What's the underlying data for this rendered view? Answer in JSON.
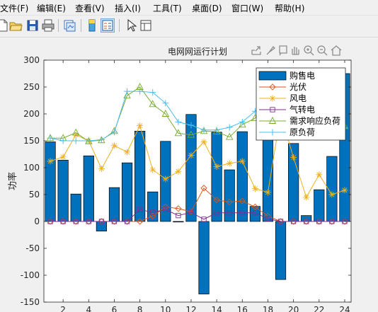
{
  "menu": [
    "文件(F)",
    "编辑(E)",
    "查看(V)",
    "插入(I)",
    "工具(T)",
    "桌面(D)",
    "窗口(W)",
    "帮助(H)"
  ],
  "toolbar": {
    "icons": [
      "new-file-icon",
      "open-folder-icon",
      "save-icon",
      "print-icon",
      "copy-figure-icon",
      "colorbar-icon",
      "legend-icon",
      "pointer-icon",
      "property-editor-icon"
    ]
  },
  "axes_toolbar": {
    "icons": [
      "export-icon",
      "brush-icon",
      "data-tips-icon",
      "pan-hand-icon",
      "zoom-in-icon",
      "zoom-out-icon",
      "home-icon"
    ]
  },
  "chart_data": {
    "type": "bar",
    "title": "电网网运行计划",
    "xlabel": "",
    "ylabel": "功率",
    "xlim": [
      0.5,
      24.5
    ],
    "ylim": [
      -150,
      300
    ],
    "yticks": [
      -150,
      -100,
      -50,
      0,
      50,
      100,
      150,
      200,
      250,
      300
    ],
    "xticks": [
      2,
      4,
      6,
      8,
      10,
      12,
      14,
      16,
      18,
      20,
      22,
      24
    ],
    "x": [
      1,
      2,
      3,
      4,
      5,
      6,
      7,
      8,
      9,
      10,
      11,
      12,
      13,
      14,
      15,
      16,
      17,
      18,
      19,
      20,
      21,
      22,
      23,
      24
    ],
    "grid": false,
    "legend_position": "top-right",
    "series": [
      {
        "name": "购售电",
        "kind": "bar",
        "color": "#0072bd",
        "values": [
          148,
          114,
          51,
          122,
          -18,
          63,
          109,
          168,
          55,
          149,
          -1,
          199,
          -135,
          166,
          96,
          167,
          28,
          160,
          -108,
          145,
          11,
          59,
          121,
          275
        ]
      },
      {
        "name": "光伏",
        "kind": "line",
        "marker": "diamond",
        "color": "#d95319",
        "values": [
          0,
          0,
          0,
          0,
          0,
          0,
          0,
          0,
          10,
          27,
          24,
          18,
          62,
          40,
          36,
          38,
          27,
          10,
          0,
          0,
          0,
          0,
          0,
          0
        ]
      },
      {
        "name": "风电",
        "kind": "line",
        "marker": "star",
        "color": "#edb120",
        "values": [
          112,
          120,
          161,
          150,
          98,
          141,
          129,
          178,
          96,
          79,
          93,
          123,
          148,
          102,
          108,
          112,
          61,
          54,
          200,
          119,
          45,
          87,
          50,
          58
        ]
      },
      {
        "name": "气转电",
        "kind": "line",
        "marker": "square",
        "color": "#7e2f8e",
        "values": [
          0,
          0,
          0,
          0,
          0,
          0,
          0,
          22,
          17,
          22,
          11,
          17,
          4,
          16,
          16,
          16,
          16,
          5,
          0,
          0,
          0,
          0,
          0,
          0
        ]
      },
      {
        "name": "需求响应负荷",
        "kind": "line",
        "marker": "triangle",
        "color": "#77ac30",
        "values": [
          155,
          155,
          165,
          149,
          151,
          168,
          234,
          250,
          218,
          200,
          164,
          161,
          168,
          167,
          157,
          180,
          192,
          230,
          214,
          170,
          174,
          170,
          166,
          177
        ]
      },
      {
        "name": "原负荷",
        "kind": "line",
        "marker": "plus",
        "color": "#4dbeee",
        "values": [
          155,
          150,
          150,
          150,
          152,
          166,
          242,
          242,
          240,
          220,
          185,
          179,
          170,
          170,
          175,
          185,
          205,
          230,
          230,
          185,
          180,
          182,
          176,
          174
        ]
      }
    ]
  }
}
